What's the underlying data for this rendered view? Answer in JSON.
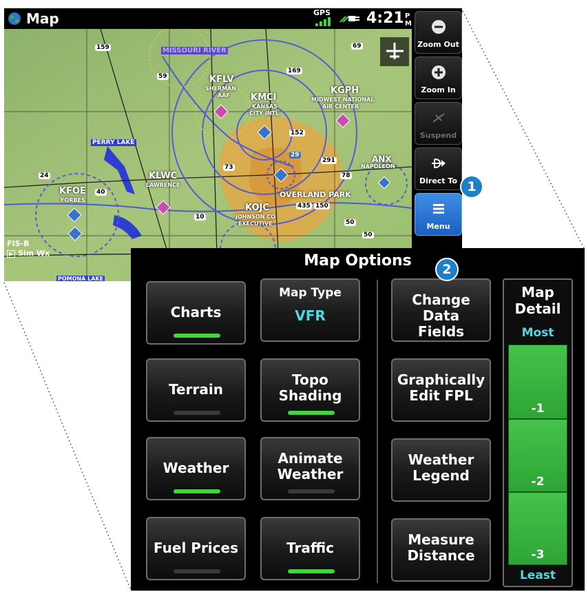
{
  "map_screen": {
    "title": "Map",
    "gps_label": "GPS",
    "clock": "4:21",
    "clock_suffix": "P M",
    "fis_label": "FIS-B",
    "sim_wx_label": "Sim Wx",
    "labels": [
      {
        "text": "MISSOURI RIVER",
        "color": "#b7a8ff"
      },
      {
        "text": "KFLV"
      },
      {
        "text": "SHERMAN"
      },
      {
        "text": "AAF"
      },
      {
        "text": "KMCI"
      },
      {
        "text": "KANSAS"
      },
      {
        "text": "CITY INTL"
      },
      {
        "text": "KGPH"
      },
      {
        "text": "MIDWEST NATIONAL"
      },
      {
        "text": "AIR CENTER"
      },
      {
        "text": "PERRY LAKE"
      },
      {
        "text": "KLWC"
      },
      {
        "text": "LAWRENCE"
      },
      {
        "text": "ANX"
      },
      {
        "text": "NAPOLEON"
      },
      {
        "text": "KFOE"
      },
      {
        "text": "FORBES"
      },
      {
        "text": "OVERLAND PARK"
      },
      {
        "text": "KOJC"
      },
      {
        "text": "JOHNSON CO"
      },
      {
        "text": "EXECUTIVE"
      },
      {
        "text": "POMONA LAKE"
      }
    ],
    "road_shields": [
      "159",
      "69",
      "59",
      "169",
      "152",
      "29",
      "73",
      "291",
      "78",
      "24",
      "40",
      "10",
      "435",
      "150",
      "50",
      "50"
    ],
    "side_buttons": [
      {
        "label": "Zoom Out",
        "icon": "zoom-out-icon",
        "enabled": true
      },
      {
        "label": "Zoom In",
        "icon": "zoom-in-icon",
        "enabled": true
      },
      {
        "label": "Suspend",
        "icon": "suspend-icon",
        "enabled": false
      },
      {
        "label": "Direct To",
        "icon": "direct-to-icon",
        "enabled": true
      },
      {
        "label": "Menu",
        "icon": "menu-icon",
        "enabled": true
      }
    ]
  },
  "callouts": [
    "1",
    "2"
  ],
  "options_panel": {
    "title": "Map Options",
    "buttons": [
      {
        "label": "Charts",
        "indicator": "on"
      },
      {
        "sub": "Map Type",
        "value": "VFR"
      },
      {
        "label": "Change Data Fields"
      },
      {
        "label": "Terrain",
        "indicator": "off"
      },
      {
        "label": "Topo Shading",
        "indicator": "on"
      },
      {
        "label": "Graphically Edit FPL"
      },
      {
        "label": "Weather",
        "indicator": "on"
      },
      {
        "label": "Animate Weather",
        "indicator": "off"
      },
      {
        "label": "Weather Legend"
      },
      {
        "label": "Fuel Prices",
        "indicator": "off"
      },
      {
        "label": "Traffic",
        "indicator": "on"
      },
      {
        "label": "Measure Distance"
      }
    ],
    "map_detail": {
      "title_line1": "Map",
      "title_line2": "Detail",
      "most": "Most",
      "least": "Least",
      "levels": [
        "-1",
        "-2",
        "-3"
      ],
      "selected_level": "Most"
    }
  },
  "colors": {
    "accent_cyan": "#4ed8e0",
    "indicator_on": "#3ed63b",
    "menu_blue": "#2f7ad8",
    "callout_blue": "#1f7fc8"
  }
}
